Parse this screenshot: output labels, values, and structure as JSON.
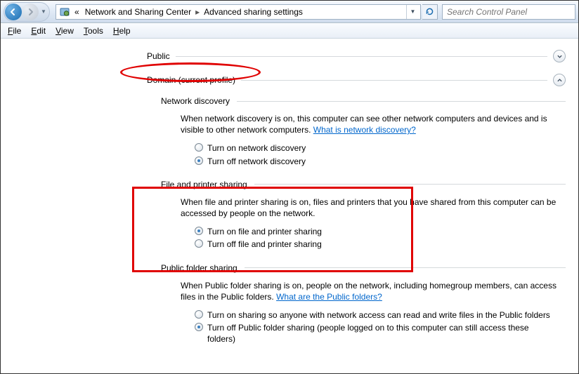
{
  "nav": {
    "breadcrumb_prefix": "«",
    "crumb1": "Network and Sharing Center",
    "crumb2": "Advanced sharing settings"
  },
  "search": {
    "placeholder": "Search Control Panel"
  },
  "menu": {
    "file": "File",
    "edit": "Edit",
    "view": "View",
    "tools": "Tools",
    "help": "Help"
  },
  "profiles": {
    "public": "Public",
    "domain": "Domain (current profile)"
  },
  "sections": {
    "nd": {
      "title": "Network discovery",
      "desc1": "When network discovery is on, this computer can see other network computers and devices and is visible to other network computers. ",
      "link": "What is network discovery?",
      "opt_on": "Turn on network discovery",
      "opt_off": "Turn off network discovery",
      "selected": "off"
    },
    "fp": {
      "title": "File and printer sharing",
      "desc": "When file and printer sharing is on, files and printers that you have shared from this computer can be accessed by people on the network.",
      "opt_on": "Turn on file and printer sharing",
      "opt_off": "Turn off file and printer sharing",
      "selected": "on"
    },
    "pf": {
      "title": "Public folder sharing",
      "desc1": "When Public folder sharing is on, people on the network, including homegroup members, can access files in the Public folders. ",
      "link": "What are the Public folders?",
      "opt_on": "Turn on sharing so anyone with network access can read and write files in the Public folders",
      "opt_off": "Turn off Public folder sharing (people logged on to this computer can still access these folders)",
      "selected": "off"
    }
  }
}
